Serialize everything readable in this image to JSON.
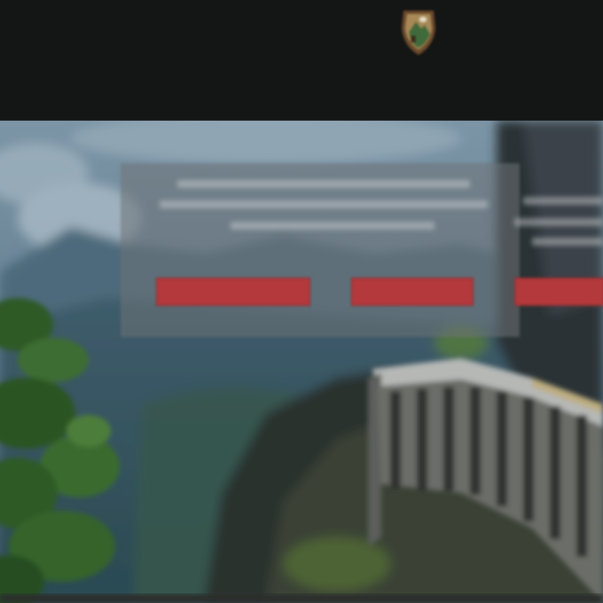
{
  "header": {
    "title": "",
    "subtitle": "",
    "logo_icon": "arrowhead-logo-icon"
  },
  "overlay": {
    "heading": "",
    "buttons": [
      {
        "label": ""
      },
      {
        "label": ""
      },
      {
        "label": ""
      }
    ]
  },
  "colors": {
    "header_bg": "#141515",
    "button_red": "#b3393c",
    "overlay_bg": "#6e7376"
  }
}
